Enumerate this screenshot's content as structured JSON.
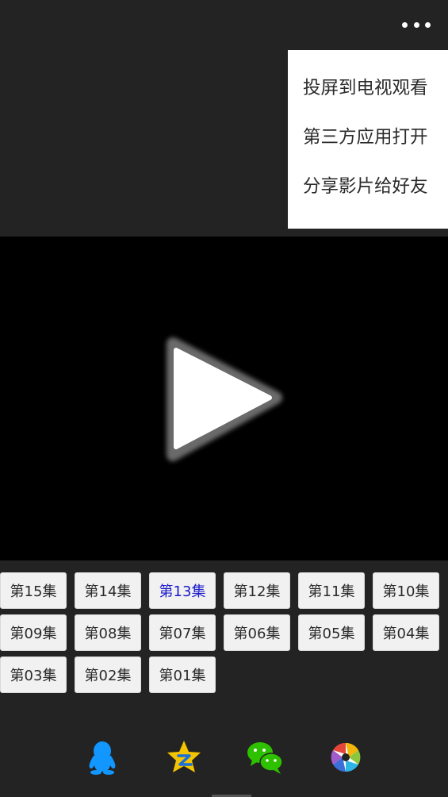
{
  "header": {
    "more_icon": "more-horizontal-icon"
  },
  "menu": {
    "items": [
      {
        "label": "投屏到电视观看"
      },
      {
        "label": "第三方应用打开"
      },
      {
        "label": "分享影片给好友"
      }
    ]
  },
  "player": {
    "play_icon": "play-icon"
  },
  "episodes": {
    "active": "第13集",
    "rows": [
      [
        "第15集",
        "第14集",
        "第13集",
        "第12集",
        "第11集",
        "第10集"
      ],
      [
        "第09集",
        "第08集",
        "第07集",
        "第06集",
        "第05集",
        "第04集"
      ],
      [
        "第03集",
        "第02集",
        "第01集"
      ]
    ]
  },
  "share": {
    "icons": [
      "qq-icon",
      "qzone-icon",
      "wechat-icon",
      "moments-icon"
    ]
  },
  "colors": {
    "background": "#232323",
    "menu_bg": "#ffffff",
    "active_episode": "#1a1acc",
    "qq": "#1296ff",
    "qzone": "#f5c400",
    "wechat": "#2dc100"
  }
}
